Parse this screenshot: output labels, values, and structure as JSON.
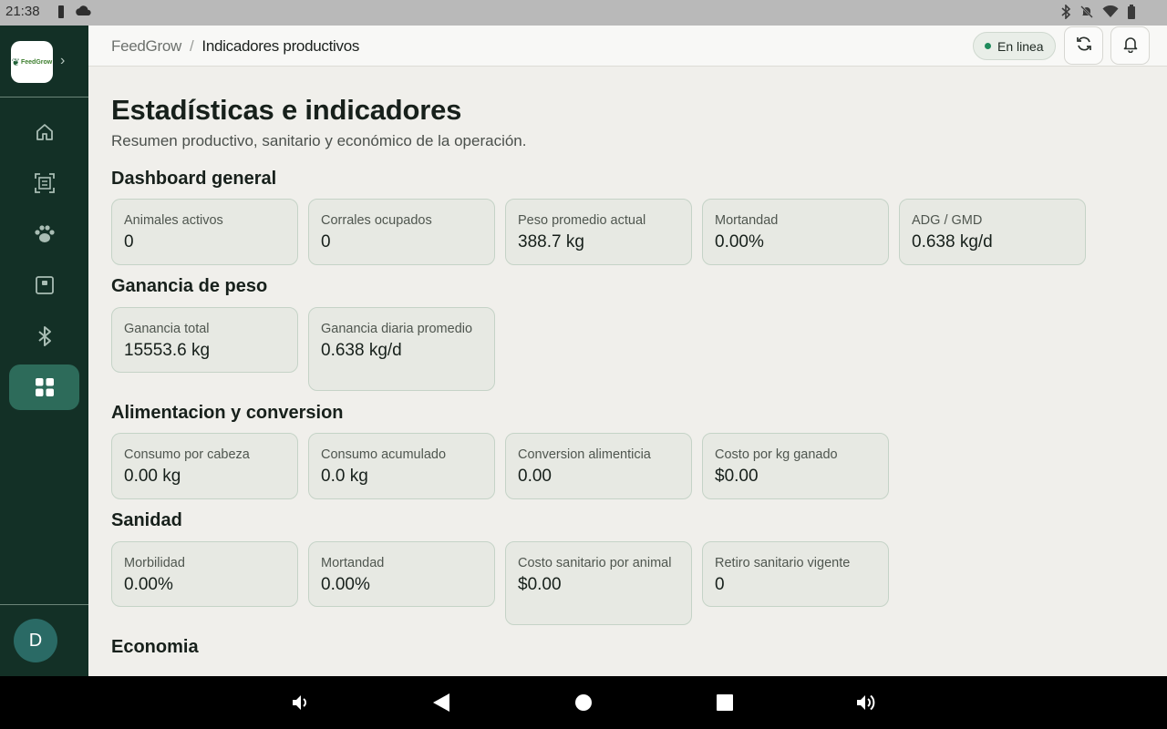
{
  "status_bar": {
    "time": "21:38"
  },
  "app": {
    "logo_text": "FeedGrow",
    "avatar_initial": "D"
  },
  "breadcrumb": {
    "root": "FeedGrow",
    "separator": "/",
    "current": "Indicadores productivos"
  },
  "header": {
    "online_label": "En linea"
  },
  "page": {
    "title": "Estadísticas e indicadores",
    "subtitle": "Resumen productivo, sanitario y económico de la operación."
  },
  "sections": [
    {
      "title": "Dashboard general",
      "cards": [
        {
          "label": "Animales activos",
          "value": "0"
        },
        {
          "label": "Corrales ocupados",
          "value": "0"
        },
        {
          "label": "Peso promedio actual",
          "value": "388.7 kg"
        },
        {
          "label": "Mortandad",
          "value": "0.00%"
        },
        {
          "label": "ADG / GMD",
          "value": "0.638 kg/d"
        }
      ]
    },
    {
      "title": "Ganancia de peso",
      "cards": [
        {
          "label": "Ganancia total",
          "value": "15553.6 kg"
        },
        {
          "label": "Ganancia diaria promedio",
          "value": "0.638 kg/d"
        }
      ]
    },
    {
      "title": "Alimentacion y conversion",
      "cards": [
        {
          "label": "Consumo por cabeza",
          "value": "0.00 kg"
        },
        {
          "label": "Consumo acumulado",
          "value": "0.0 kg"
        },
        {
          "label": "Conversion alimenticia",
          "value": "0.00"
        },
        {
          "label": "Costo por kg ganado",
          "value": "$0.00"
        }
      ]
    },
    {
      "title": "Sanidad",
      "cards": [
        {
          "label": "Morbilidad",
          "value": "0.00%"
        },
        {
          "label": "Mortandad",
          "value": "0.00%"
        },
        {
          "label": "Costo sanitario por animal",
          "value": "$0.00"
        },
        {
          "label": "Retiro sanitario vigente",
          "value": "0"
        }
      ]
    },
    {
      "title": "Economia",
      "cards": []
    }
  ],
  "sidebar": {
    "items": [
      {
        "icon": "home-icon"
      },
      {
        "icon": "scan-icon"
      },
      {
        "icon": "paw-icon"
      },
      {
        "icon": "scale-icon"
      },
      {
        "icon": "bluetooth-icon"
      },
      {
        "icon": "grid-icon",
        "active": true
      }
    ]
  },
  "colors": {
    "sidebar": "#133026",
    "active": "#2d6b5a",
    "online": "#1f8a5b",
    "card_border": "#c5d3c7",
    "card_bg": "#e7e9e3"
  }
}
